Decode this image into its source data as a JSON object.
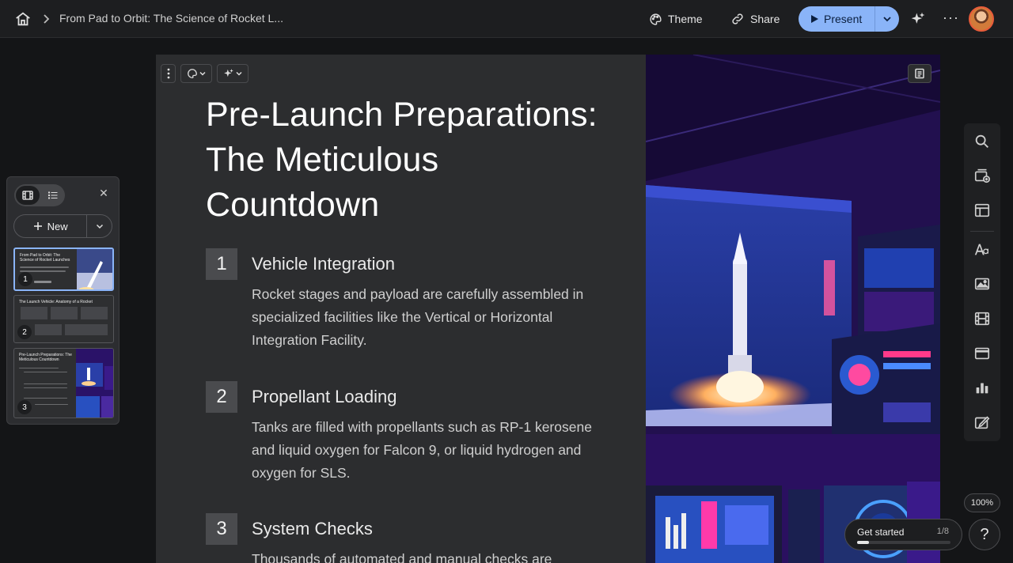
{
  "topbar": {
    "doc_title": "From Pad to Orbit: The Science of Rocket L...",
    "theme_label": "Theme",
    "share_label": "Share",
    "present_label": "Present",
    "icons": [
      "home-icon",
      "chevron-right-icon",
      "palette-icon",
      "link-icon",
      "play-icon",
      "chevron-down-icon",
      "sparkle-icon",
      "more-icon",
      "avatar"
    ]
  },
  "slide": {
    "title": "Pre-Launch Preparations: The Meticulous Countdown",
    "steps": [
      {
        "num": "1",
        "heading": "Vehicle Integration",
        "body": "Rocket stages and payload are carefully assembled in specialized facilities like the Vertical or Horizontal Integration Facility."
      },
      {
        "num": "2",
        "heading": "Propellant Loading",
        "body": "Tanks are filled with propellants such as RP-1 kerosene and liquid oxygen for Falcon 9, or liquid hydrogen and oxygen for SLS."
      },
      {
        "num": "3",
        "heading": "System Checks",
        "body": "Thousands of automated and manual checks are"
      }
    ]
  },
  "panel": {
    "new_label": "New",
    "thumbs": [
      {
        "num": "1",
        "title": "From Pad to Orbit: The Science of Rocket Launches"
      },
      {
        "num": "2",
        "title": "The Launch Vehicle: Anatomy of a Rocket"
      },
      {
        "num": "3",
        "title": "Pre-Launch Preparations: The Meticulous Countdown"
      }
    ]
  },
  "zoom_label": "100%",
  "get_started": {
    "label": "Get started",
    "count": "1/8",
    "progress": 0.125
  },
  "help_label": "?",
  "colors": {
    "accent": "#8ab4f8",
    "background": "#141517",
    "slide": "#2c2d2f"
  }
}
